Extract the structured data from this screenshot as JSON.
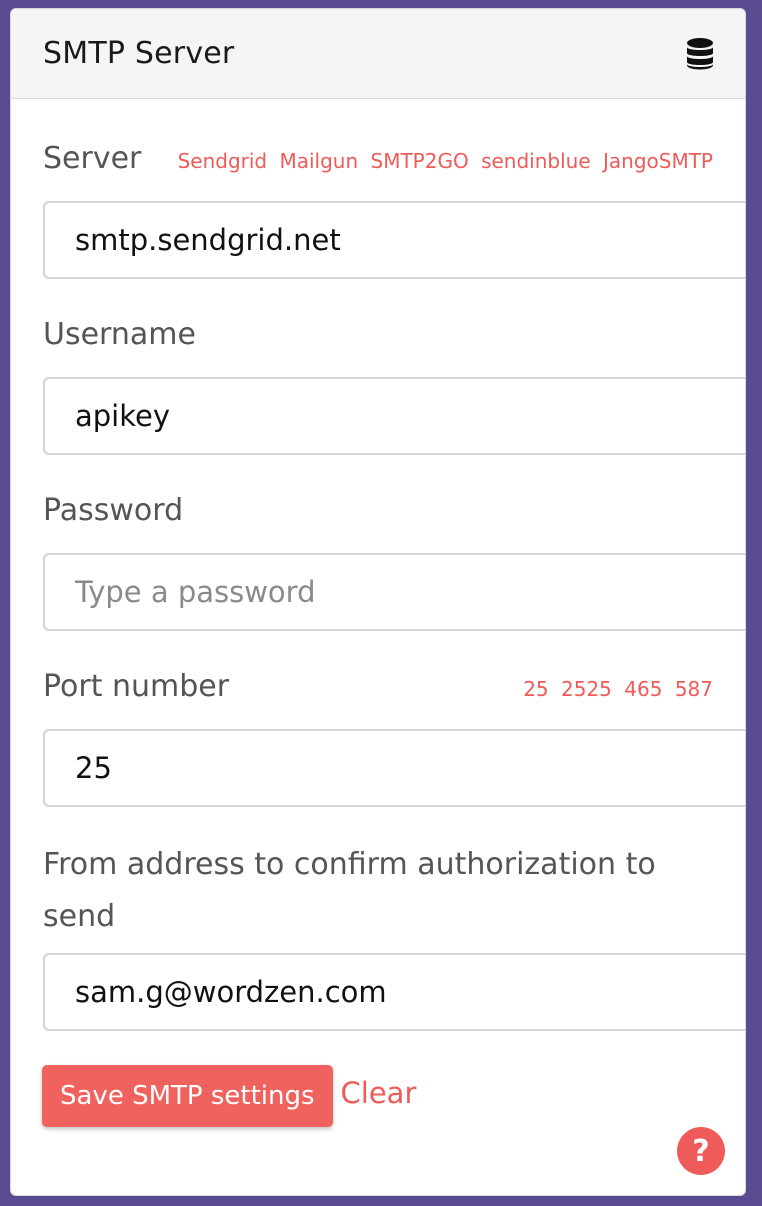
{
  "panel": {
    "title": "SMTP Server",
    "header_icon": "database-icon"
  },
  "server": {
    "label": "Server",
    "value": "smtp.sendgrid.net",
    "presets": [
      "Sendgrid",
      "Mailgun",
      "SMTP2GO",
      "sendinblue",
      "JangoSMTP"
    ]
  },
  "username": {
    "label": "Username",
    "value": "apikey"
  },
  "password": {
    "label": "Password",
    "value": "",
    "placeholder": "Type a password"
  },
  "port": {
    "label": "Port number",
    "value": "25",
    "presets": [
      "25",
      "2525",
      "465",
      "587"
    ]
  },
  "from_address": {
    "label": "From address to confirm authorization to send",
    "value": "sam.g@wordzen.com"
  },
  "actions": {
    "save_label": "Save SMTP settings",
    "clear_label": "Clear"
  },
  "help": {
    "label": "?"
  },
  "colors": {
    "accent": "#ee5b59",
    "background": "#5a4a8f"
  }
}
